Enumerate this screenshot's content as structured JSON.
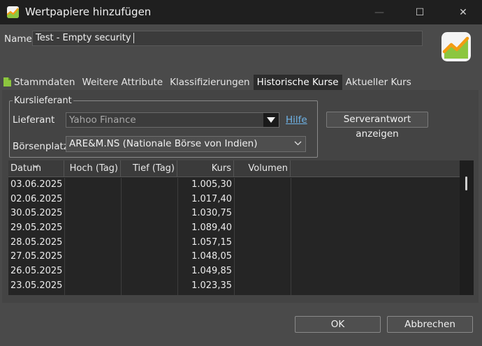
{
  "window": {
    "title": "Wertpapiere hinzufügen",
    "controls": {
      "minimize": "—",
      "maximize": "☐",
      "close": "✕"
    }
  },
  "name_field": {
    "label": "Name",
    "value": "Test - Empty security"
  },
  "tabs": [
    {
      "label": "Stammdaten",
      "icon": "document-icon"
    },
    {
      "label": "Weitere Attribute"
    },
    {
      "label": "Klassifizierungen"
    },
    {
      "label": "Historische Kurse",
      "active": true
    },
    {
      "label": "Aktueller Kurs"
    }
  ],
  "quote_provider": {
    "group_title": "Kurslieferant",
    "provider_label": "Lieferant",
    "provider_value": "Yahoo Finance",
    "help_link": "Hilfe",
    "exchange_label": "Börsenplatz",
    "exchange_value": "ARE&M.NS (Nationale Börse von Indien)",
    "server_button": "Serverantwort anzeigen"
  },
  "table": {
    "columns": [
      "Datum",
      "Hoch (Tag)",
      "Tief (Tag)",
      "Kurs",
      "Volumen"
    ],
    "rows": [
      {
        "date": "03.06.2025",
        "high": "",
        "low": "",
        "close": "1.005,30",
        "volume": ""
      },
      {
        "date": "02.06.2025",
        "high": "",
        "low": "",
        "close": "1.017,40",
        "volume": ""
      },
      {
        "date": "30.05.2025",
        "high": "",
        "low": "",
        "close": "1.030,75",
        "volume": ""
      },
      {
        "date": "29.05.2025",
        "high": "",
        "low": "",
        "close": "1.089,40",
        "volume": ""
      },
      {
        "date": "28.05.2025",
        "high": "",
        "low": "",
        "close": "1.057,15",
        "volume": ""
      },
      {
        "date": "27.05.2025",
        "high": "",
        "low": "",
        "close": "1.048,05",
        "volume": ""
      },
      {
        "date": "26.05.2025",
        "high": "",
        "low": "",
        "close": "1.049,85",
        "volume": ""
      },
      {
        "date": "23.05.2025",
        "high": "",
        "low": "",
        "close": "1.023,35",
        "volume": ""
      }
    ]
  },
  "buttons": {
    "ok": "OK",
    "cancel": "Abbrechen"
  },
  "colors": {
    "title_bar": "#1f1f1f",
    "dialog_bg": "#4a4a4a",
    "table_bg": "#252525",
    "link": "#6fb4e8"
  }
}
